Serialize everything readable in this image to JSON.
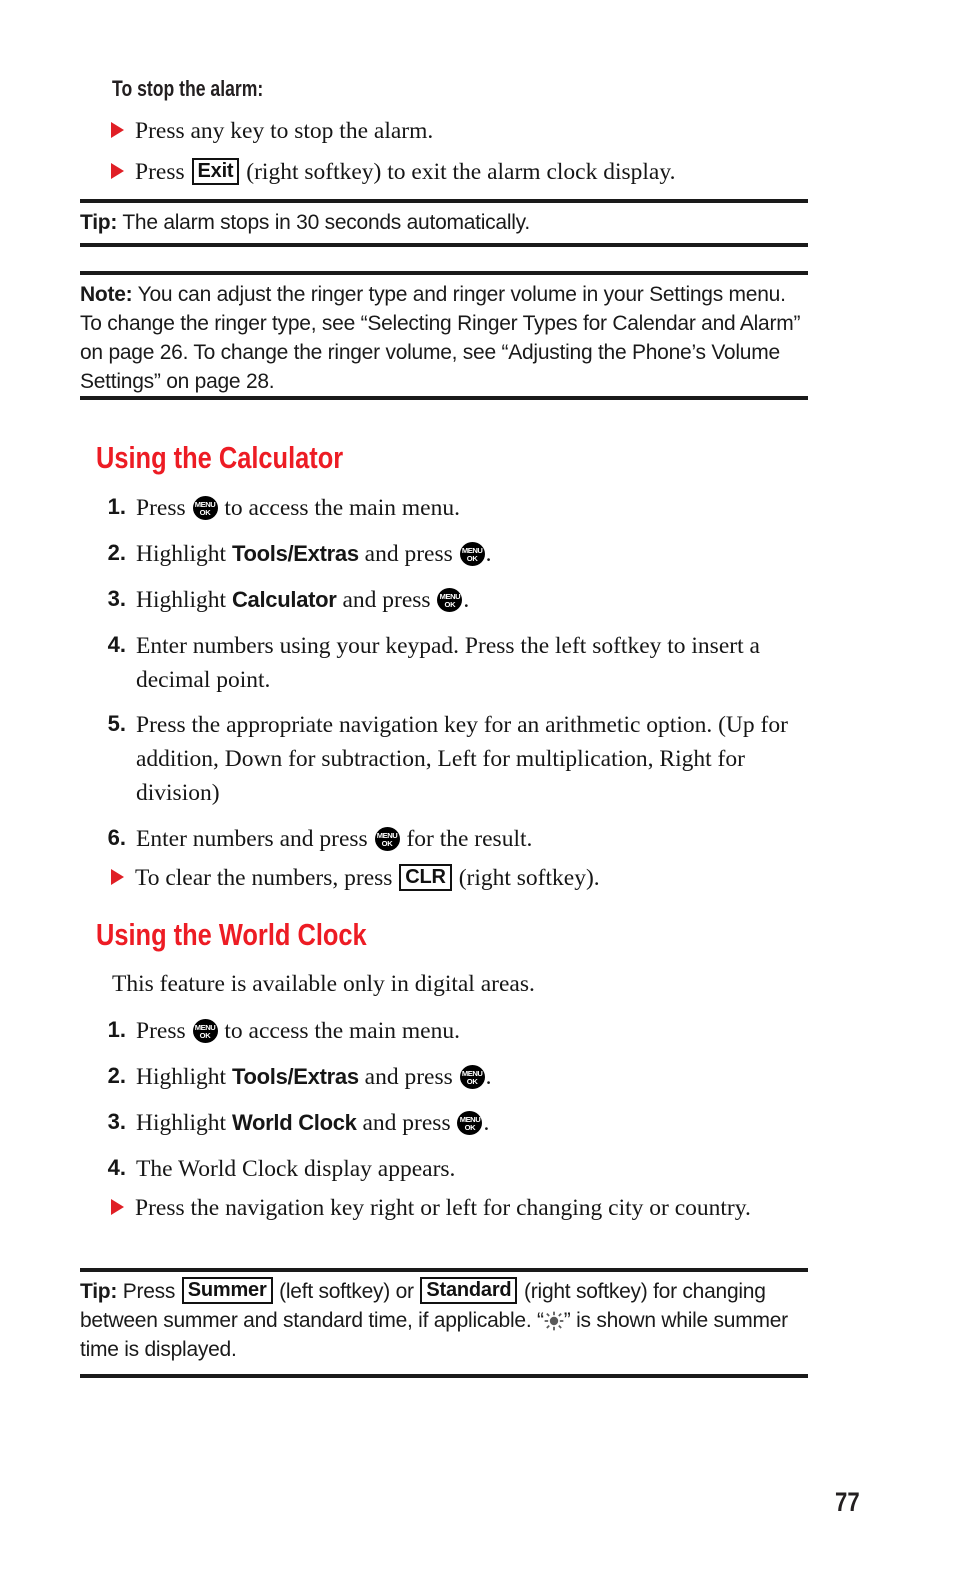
{
  "colors": {
    "accent_red": "#ED1C24",
    "bullet_red": "#E01F26",
    "text_black": "#161616",
    "rule_black": "#1A1A1A"
  },
  "icons": {
    "menu_ok": {
      "top_label": "MENU",
      "bottom_label": "OK"
    },
    "bullet": "triangle-right-icon",
    "sun": "sun-icon"
  },
  "sections": {
    "stop_alarm": {
      "heading": "To stop the alarm:",
      "bullets": [
        {
          "pre": "Press any key to stop the alarm.",
          "key": null,
          "post": null
        },
        {
          "pre": "Press ",
          "key": "Exit",
          "post": " (right softkey) to exit the alarm clock display."
        }
      ]
    },
    "tip_alarm": {
      "lead": "Tip:",
      "text": " The alarm stops in 30 seconds automatically."
    },
    "note_ringer": {
      "lead": "Note:",
      "text": " You can adjust the ringer type and ringer volume in your Settings menu. To change the ringer type, see “Selecting Ringer Types for Calendar and Alarm” on page 26. To change the ringer volume, see “Adjusting the Phone’s Volume Settings” on page 28."
    },
    "calculator": {
      "heading": "Using the Calculator",
      "steps": [
        {
          "num": "1.",
          "parts": [
            "Press ",
            "MENUOK",
            " to access the main menu."
          ]
        },
        {
          "num": "2.",
          "parts": [
            "Highlight ",
            "BOLD:Tools/Extras",
            " and press ",
            "MENUOK",
            "."
          ]
        },
        {
          "num": "3.",
          "parts": [
            "Highlight ",
            "BOLD:Calculator",
            " and press ",
            "MENUOK",
            "."
          ]
        },
        {
          "num": "4.",
          "parts": [
            "Enter numbers using your keypad. Press the left softkey to insert a decimal point."
          ]
        },
        {
          "num": "5.",
          "parts": [
            "Press the appropriate navigation key for an arithmetic option. (Up for addition, Down for subtraction, Left for multiplication, Right for division)"
          ]
        },
        {
          "num": "6.",
          "parts": [
            "Enter numbers and press ",
            "MENUOK",
            " for the result."
          ]
        }
      ],
      "bullet": {
        "pre": "To clear the numbers, press ",
        "key": "CLR",
        "post": " (right softkey)."
      }
    },
    "world_clock": {
      "heading": "Using the World Clock",
      "intro": "This feature is available only in digital areas.",
      "steps": [
        {
          "num": "1.",
          "parts": [
            "Press ",
            "MENUOK",
            " to access the main menu."
          ]
        },
        {
          "num": "2.",
          "parts": [
            "Highlight ",
            "BOLD:Tools/Extras",
            " and press ",
            "MENUOK",
            "."
          ]
        },
        {
          "num": "3.",
          "parts": [
            "Highlight ",
            "BOLD:World Clock",
            " and press ",
            "MENUOK",
            "."
          ]
        },
        {
          "num": "4.",
          "parts": [
            "The World Clock display appears."
          ]
        }
      ],
      "bullet": {
        "text": "Press the navigation key right or left for changing city or country."
      }
    },
    "tip_summer": {
      "lead": "Tip:",
      "part1": " Press ",
      "key1": "Summer",
      "part2": " (left softkey) or ",
      "key2": "Standard",
      "part3": " (right softkey) for changing between summer and standard time, if applicable. “",
      "part4": "” is shown while summer time is displayed."
    }
  },
  "footer": {
    "page_number": "77"
  }
}
